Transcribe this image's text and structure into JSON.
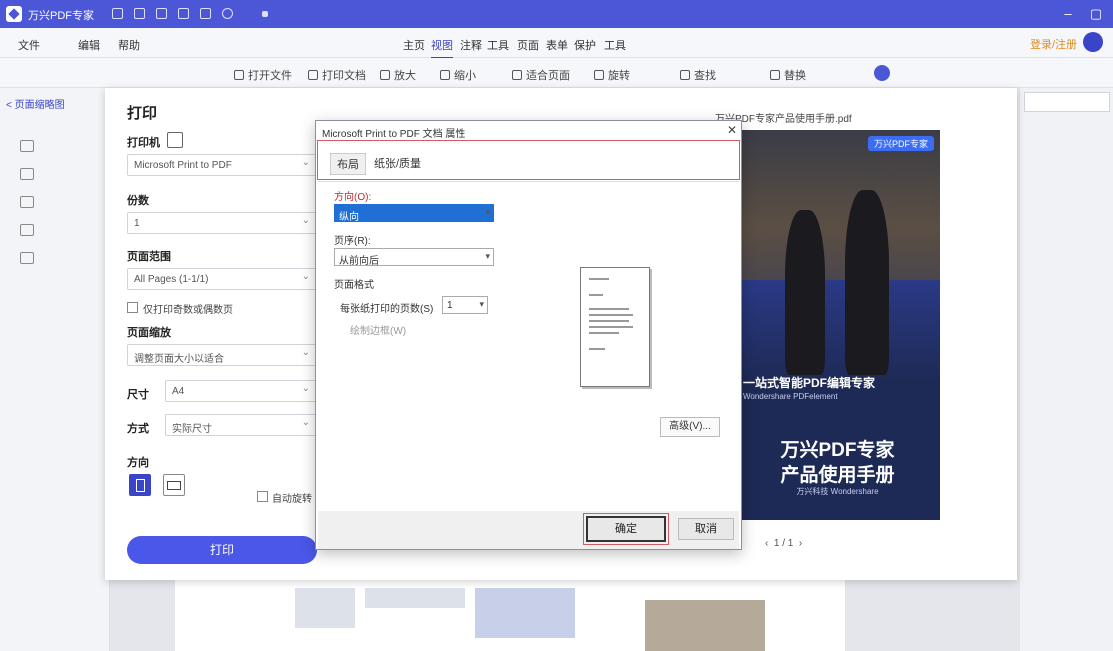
{
  "app": {
    "name": "万兴PDF专家",
    "title_icons": [
      "file-icon",
      "save-icon",
      "print-icon",
      "undo-icon",
      "redo-icon",
      "more-icon"
    ]
  },
  "menu": {
    "items": [
      "文件",
      "编辑",
      "帮助"
    ]
  },
  "tabs": {
    "items": [
      "主页",
      "视图",
      "注释",
      "工具",
      "页面",
      "表单",
      "保护",
      "工具"
    ],
    "active_index": 1
  },
  "account": {
    "login_label": "登录/注册"
  },
  "toolbar": {
    "items": [
      "打开文件",
      "打印文档",
      "放大",
      "缩小",
      "适合页面",
      "旋转",
      "查找",
      "替换"
    ]
  },
  "left_rail": {
    "thumb_tab": "< 页面缩略图"
  },
  "print": {
    "title": "打印",
    "printer_label": "打印机",
    "printer_value": "Microsoft Print to PDF",
    "copies_label": "份数",
    "copies_value": "1",
    "pages_label": "页面范围",
    "pages_value": "All Pages (1-1/1)",
    "odd_even_checkbox": "仅打印奇数或偶数页",
    "scale_label": "页面缩放",
    "scale_value": "调整页面大小以适合",
    "size_label": "尺寸",
    "size_value": "A4",
    "mode_label": "方式",
    "mode_value": "实际尺寸",
    "orientation_label": "方向",
    "auto_rotate": "自动旋转",
    "print_button": "打印"
  },
  "preview": {
    "filename": "万兴PDF专家产品使用手册.pdf",
    "tag": "万兴PDF专家",
    "heading": "一站式智能PDF编辑专家",
    "sub": "Wondershare PDFelement",
    "title_line1": "万兴PDF专家",
    "title_line2": "产品使用手册",
    "caption": "万兴科技 Wondershare",
    "nav": "1 / 1"
  },
  "system_dialog": {
    "title": "Microsoft Print to PDF 文档 属性",
    "close": "✕",
    "tabs": [
      "布局",
      "纸张/质量"
    ],
    "active_tab": 0,
    "orientation_label": "方向(O):",
    "orientation_value": "纵向",
    "order_label": "页序(R):",
    "order_value": "从前向后",
    "format_label": "页面格式",
    "pages_per_sheet_label": "每张纸打印的页数(S)",
    "pages_per_sheet_value": "1",
    "border_label": "绘制边框(W)",
    "advanced_button": "高级(V)...",
    "ok_button": "确定",
    "cancel_button": "取消"
  },
  "colors": {
    "accent": "#4b57d6",
    "title_bar": "#4b57d6",
    "highlight_red": "#d15b66",
    "select_blue": "#1f6fd4"
  }
}
